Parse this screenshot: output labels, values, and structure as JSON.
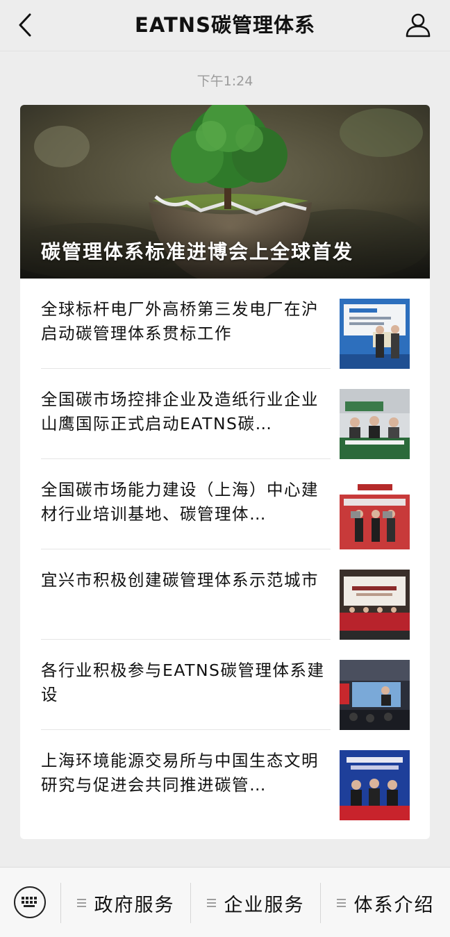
{
  "header": {
    "title": "EATNS碳管理体系",
    "back_icon": "chevron-left-icon",
    "profile_icon": "user-icon"
  },
  "timestamp": "下午1:24",
  "hero": {
    "title": "碳管理体系标准进博会上全球首发",
    "image": "tree-on-globe-photo"
  },
  "articles": [
    {
      "title": "全球标杆电厂外高桥第三发电厂在沪启动碳管理体系贯标工作",
      "thumb": "photo-ceremony-plaque"
    },
    {
      "title": "全国碳市场控排企业及造纸行业企业山鹰国际正式启动EATNS碳…",
      "thumb": "photo-meeting-table"
    },
    {
      "title": "全国碳市场能力建设（上海）中心建材行业培训基地、碳管理体…",
      "thumb": "photo-cnbm-award"
    },
    {
      "title": "宜兴市积极创建碳管理体系示范城市",
      "thumb": "photo-stage-panel"
    },
    {
      "title": "各行业积极参与EATNS碳管理体系建设",
      "thumb": "photo-conference-hall"
    },
    {
      "title": "上海环境能源交易所与中国生态文明研究与促进会共同推进碳管…",
      "thumb": "photo-signing-ceremony"
    }
  ],
  "bottom_menu": {
    "keyboard_icon": "keyboard-icon",
    "items": [
      {
        "label": "政府服务"
      },
      {
        "label": "企业服务"
      },
      {
        "label": "体系介绍"
      }
    ]
  },
  "colors": {
    "background": "#ededed",
    "card": "#ffffff",
    "timestamp": "#9b9b9b"
  }
}
